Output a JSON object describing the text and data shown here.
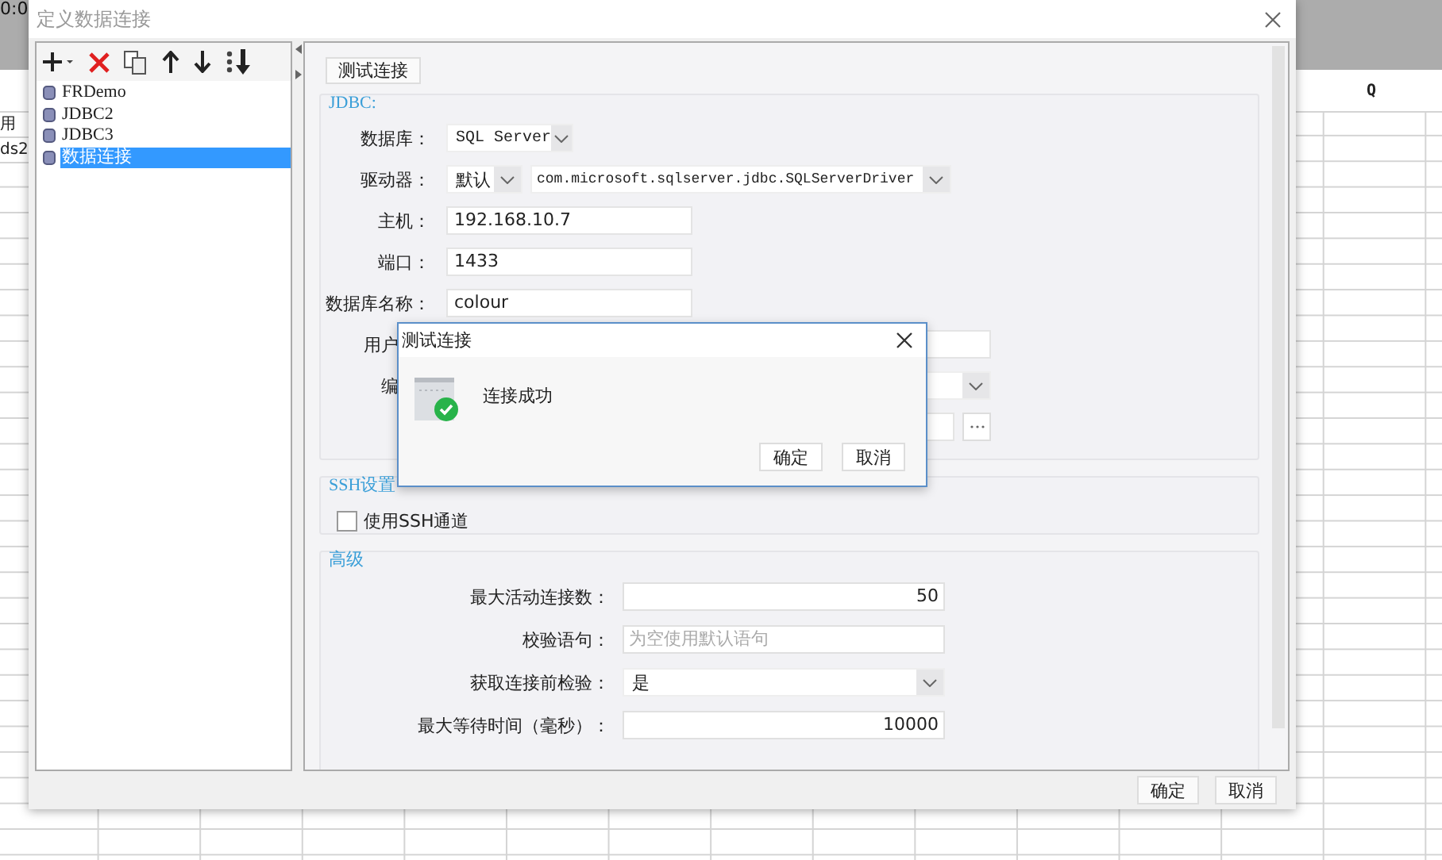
{
  "background_sheet": {
    "clock_text": "0:0",
    "column_header": "Q",
    "cells": [
      "用",
      "ds2"
    ]
  },
  "window": {
    "title": "定义数据连接"
  },
  "connections": [
    {
      "name": "FRDemo",
      "selected": false
    },
    {
      "name": "JDBC2",
      "selected": false
    },
    {
      "name": "JDBC3",
      "selected": false
    },
    {
      "name": "数据连接",
      "selected": true
    }
  ],
  "test_button": "测试连接",
  "jdbc": {
    "title": "JDBC:",
    "fields": [
      {
        "kind": "select",
        "label": "数据库：",
        "value": "SQL Server"
      },
      {
        "kind": "driver",
        "label": "驱动器：",
        "value": "默认",
        "driver_class": "com.microsoft.sqlserver.jdbc.SQLServerDriver"
      },
      {
        "kind": "text",
        "label": "主机：",
        "value": "192.168.10.7"
      },
      {
        "kind": "text",
        "label": "端口：",
        "value": "1433"
      },
      {
        "kind": "text",
        "label": "数据库名称：",
        "value": "colour"
      },
      {
        "kind": "text_partial",
        "label": "用户"
      },
      {
        "kind": "select_partial",
        "label": "编"
      },
      {
        "kind": "browse"
      }
    ]
  },
  "ssh": {
    "title": "SSH设置",
    "use_tunnel": {
      "label": "使用SSH通道",
      "checked": false
    }
  },
  "advanced": {
    "title": "高级",
    "fields": [
      {
        "kind": "number",
        "label": "最大活动连接数：",
        "value": "50"
      },
      {
        "kind": "text",
        "label": "校验语句：",
        "placeholder": "为空使用默认语句"
      },
      {
        "kind": "select",
        "label": "获取连接前检验：",
        "value": "是"
      },
      {
        "kind": "number",
        "label": "最大等待时间（毫秒）：",
        "value": "10000"
      }
    ]
  },
  "buttons": [
    "确定",
    "取消"
  ],
  "test_dialog": {
    "title": "测试连接",
    "message": "连接成功",
    "buttons": [
      "确定",
      "取消"
    ]
  }
}
